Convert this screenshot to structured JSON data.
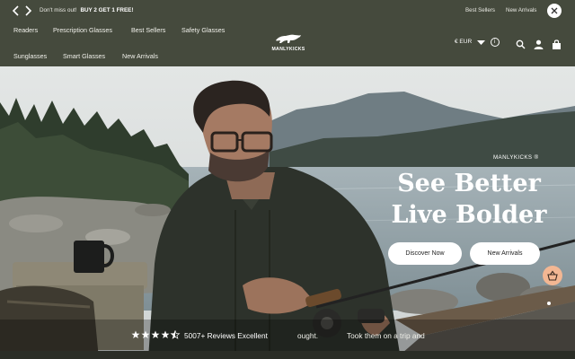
{
  "announcement": {
    "prefix": "Don't miss out!",
    "offer": "BUY 2 GET 1 FREE!"
  },
  "utility_links": {
    "best_sellers": "Best Sellers",
    "new_arrivals": "New Arrivals"
  },
  "nav": {
    "row1": [
      "Readers",
      "Prescription Glasses",
      "Best Sellers",
      "Safety Glasses"
    ],
    "row2": [
      "Sunglasses",
      "Smart Glasses",
      "New Arrivals"
    ]
  },
  "logo": {
    "text": "MANLYKICKS"
  },
  "currency": {
    "label": "€ EUR"
  },
  "hero": {
    "brand": "MANLYKICKS ®",
    "headline_line1": "See Better",
    "headline_line2": "Live Bolder",
    "cta_discover": "Discover Now",
    "cta_new": "New Arrivals"
  },
  "reviews": {
    "rating": 4.5,
    "text": "5007+ Reviews Excellent",
    "ticker_fragment": "ought.",
    "ticker_quote": "Took them on a trip and"
  },
  "colors": {
    "header_bg": "#454a3d",
    "fab_bg": "#f3b793",
    "text": "#ffffff"
  },
  "icons": [
    "chevron-left-icon",
    "chevron-right-icon",
    "close-icon",
    "search-icon",
    "user-icon",
    "bag-icon",
    "chevron-down-icon",
    "info-icon",
    "basket-icon",
    "star-icon"
  ]
}
